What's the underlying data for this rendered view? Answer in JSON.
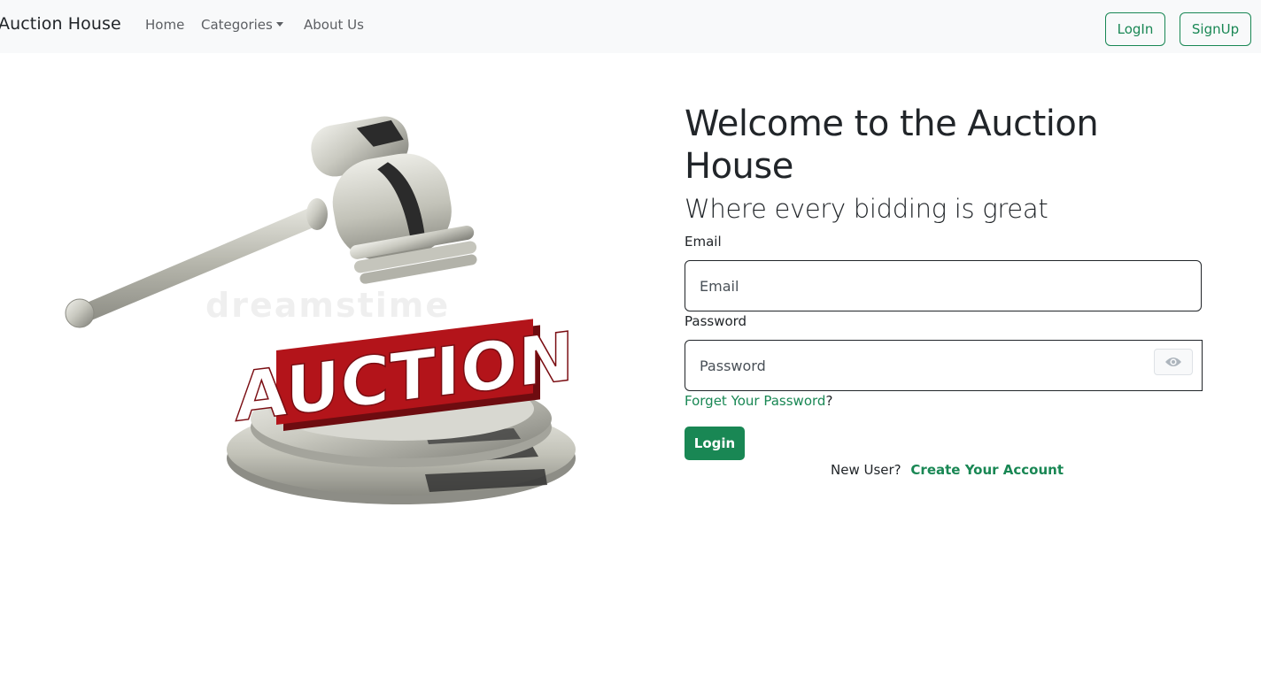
{
  "navbar": {
    "brand": "Auction House",
    "links": {
      "home": "Home",
      "categories": "Categories",
      "about": "About Us"
    },
    "login_label": "LogIn",
    "signup_label": "SignUp"
  },
  "hero": {
    "image_icon": "auction-gavel-illustration",
    "sign_text": "AUCTION",
    "watermark": "dreamstime"
  },
  "form": {
    "title": "Welcome to the Auction House",
    "subtitle": "Where every bidding is great",
    "email_label": "Email",
    "email_placeholder": "Email",
    "password_label": "Password",
    "password_placeholder": "Password",
    "toggle_icon": "eye-icon",
    "forgot_link": "Forget Your Password",
    "forgot_suffix": "?",
    "submit_label": "Login",
    "new_user_text": "New User?",
    "create_account_link": "Create Your Account"
  },
  "colors": {
    "accent": "#198754",
    "navbar_bg": "#f8f9fa",
    "text": "#212529",
    "sign_red": "#b3141a"
  }
}
